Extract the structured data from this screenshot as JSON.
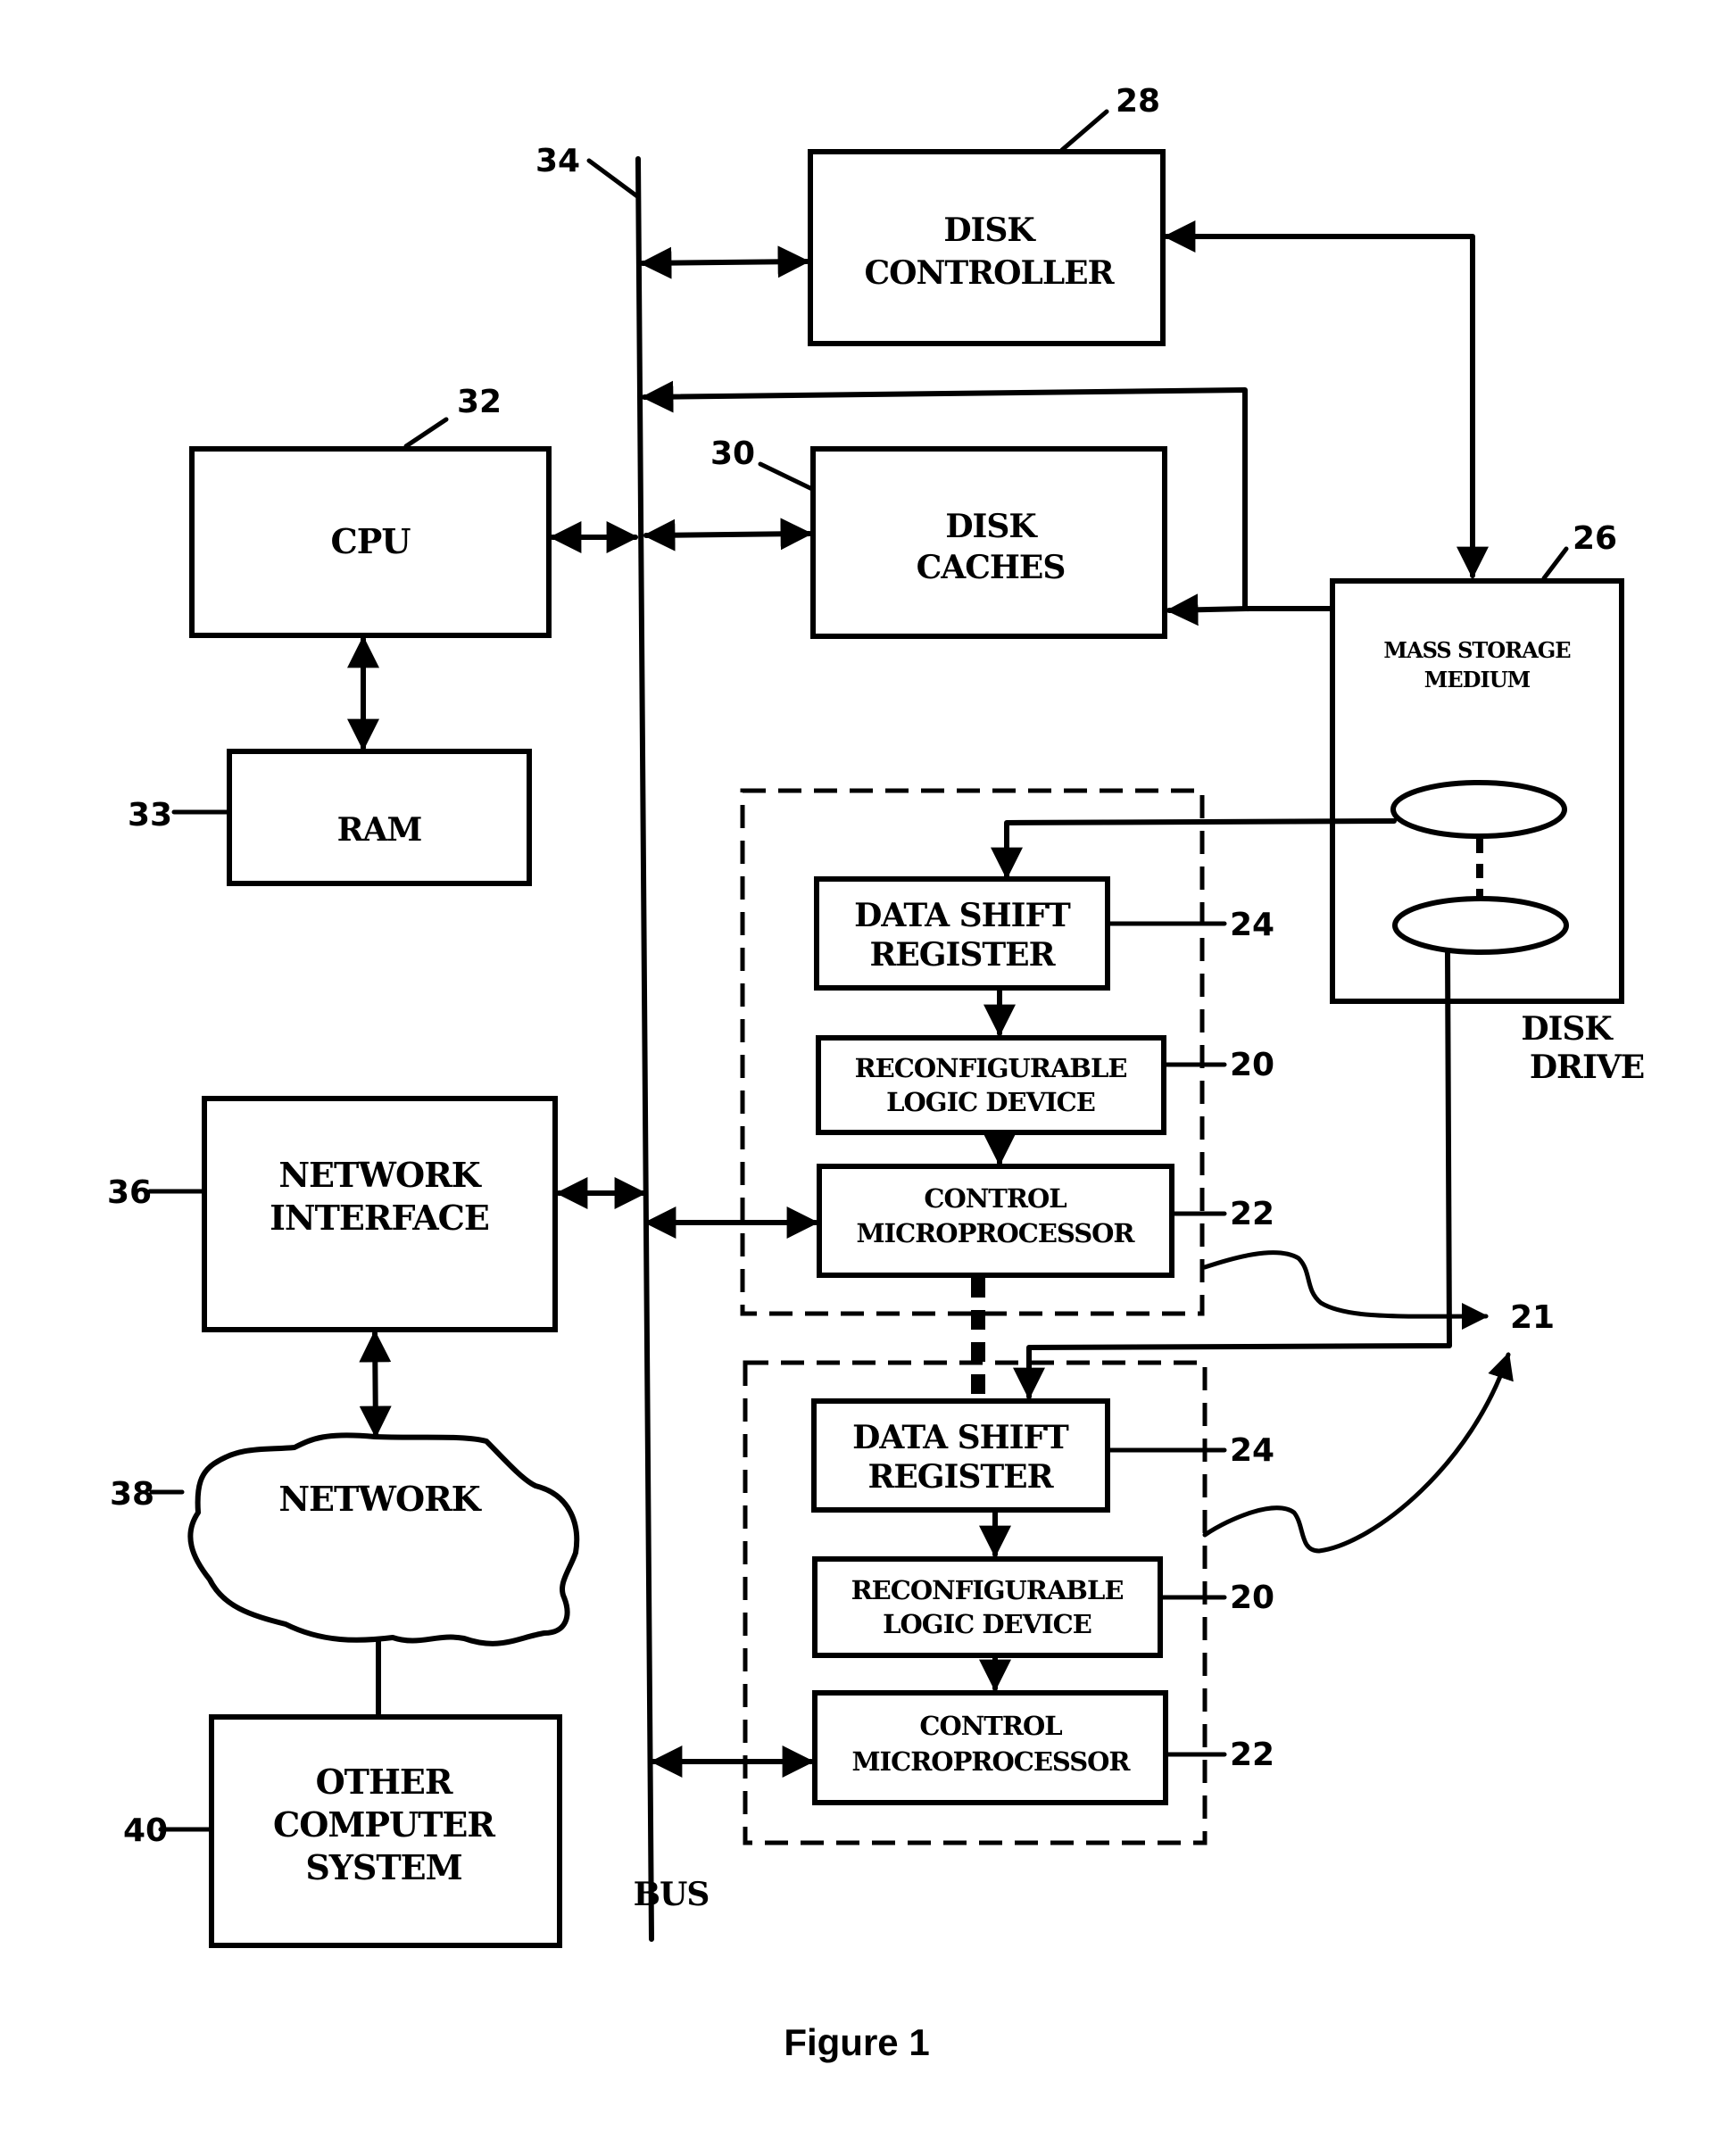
{
  "figure": {
    "caption": "Figure 1",
    "bus_label": "BUS",
    "blocks": {
      "disk_controller": {
        "lines": [
          "DISK",
          "CONTROLLER"
        ],
        "ref": "28"
      },
      "disk_caches": {
        "lines": [
          "DISK",
          "CACHES"
        ],
        "ref": "30"
      },
      "cpu": {
        "lines": [
          "CPU"
        ],
        "ref": "32"
      },
      "ram": {
        "lines": [
          "RAM"
        ],
        "ref": "33"
      },
      "mass_storage": {
        "lines": [
          "MASS STORAGE",
          "MEDIUM"
        ],
        "ref": "26"
      },
      "disk_drive_label": [
        "DISK",
        "DRIVE"
      ],
      "network_interface": {
        "lines": [
          "NETWORK",
          "INTERFACE"
        ],
        "ref": "36"
      },
      "network": {
        "lines": [
          "NETWORK"
        ],
        "ref": "38"
      },
      "other_computer": {
        "lines": [
          "OTHER",
          "COMPUTER",
          "SYSTEM"
        ],
        "ref": "40"
      },
      "bus_ref": "34",
      "module_ref": "21",
      "module_1": {
        "dsr": {
          "lines": [
            "DATA SHIFT",
            "REGISTER"
          ],
          "ref": "24"
        },
        "rld": {
          "lines": [
            "RECONFIGURABLE",
            "LOGIC DEVICE"
          ],
          "ref": "20"
        },
        "cmp": {
          "lines": [
            "CONTROL",
            "MICROPROCESSOR"
          ],
          "ref": "22"
        }
      },
      "module_2": {
        "dsr": {
          "lines": [
            "DATA SHIFT",
            "REGISTER"
          ],
          "ref": "24"
        },
        "rld": {
          "lines": [
            "RECONFIGURABLE",
            "LOGIC DEVICE"
          ],
          "ref": "20"
        },
        "cmp": {
          "lines": [
            "CONTROL",
            "MICROPROCESSOR"
          ],
          "ref": "22"
        }
      }
    }
  }
}
